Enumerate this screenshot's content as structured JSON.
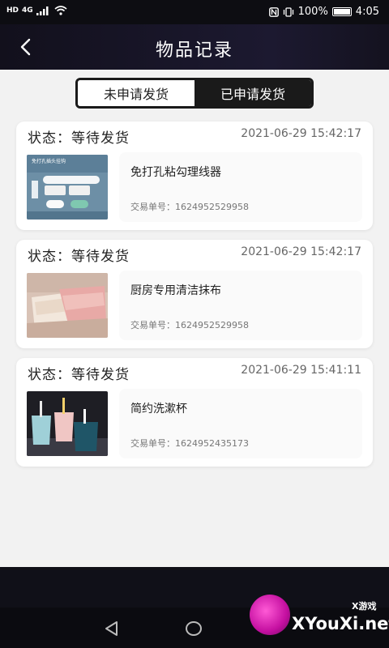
{
  "status_bar": {
    "left_labels": [
      "HD",
      "4G"
    ],
    "battery_text": "100%",
    "time": "4:05"
  },
  "header": {
    "title": "物品记录",
    "back_icon": "chevron-left-icon"
  },
  "tabs": [
    {
      "label": "未申请发货",
      "active": false
    },
    {
      "label": "已申请发货",
      "active": true
    }
  ],
  "records": [
    {
      "status_label": "状态：",
      "status": "等待发货",
      "time": "2021-06-29 15:42:17",
      "item_name": "免打孔粘勾理线器",
      "tx_label": "交易单号：",
      "tx_number": "1624952529958",
      "thumb_text": "免打孔插头挂钩"
    },
    {
      "status_label": "状态：",
      "status": "等待发货",
      "time": "2021-06-29 15:42:17",
      "item_name": "厨房专用清洁抹布",
      "tx_label": "交易单号：",
      "tx_number": "1624952529958"
    },
    {
      "status_label": "状态：",
      "status": "等待发货",
      "time": "2021-06-29 15:41:11",
      "item_name": "简约洗漱杯",
      "tx_label": "交易单号：",
      "tx_number": "1624952435173"
    }
  ],
  "watermark": {
    "site": "XYouXi.net",
    "small": "X游戏"
  },
  "colors": {
    "header_bg": "#1c1930",
    "page_bg": "#f2f2f2",
    "active_tab_bg": "#1a1a1a"
  }
}
